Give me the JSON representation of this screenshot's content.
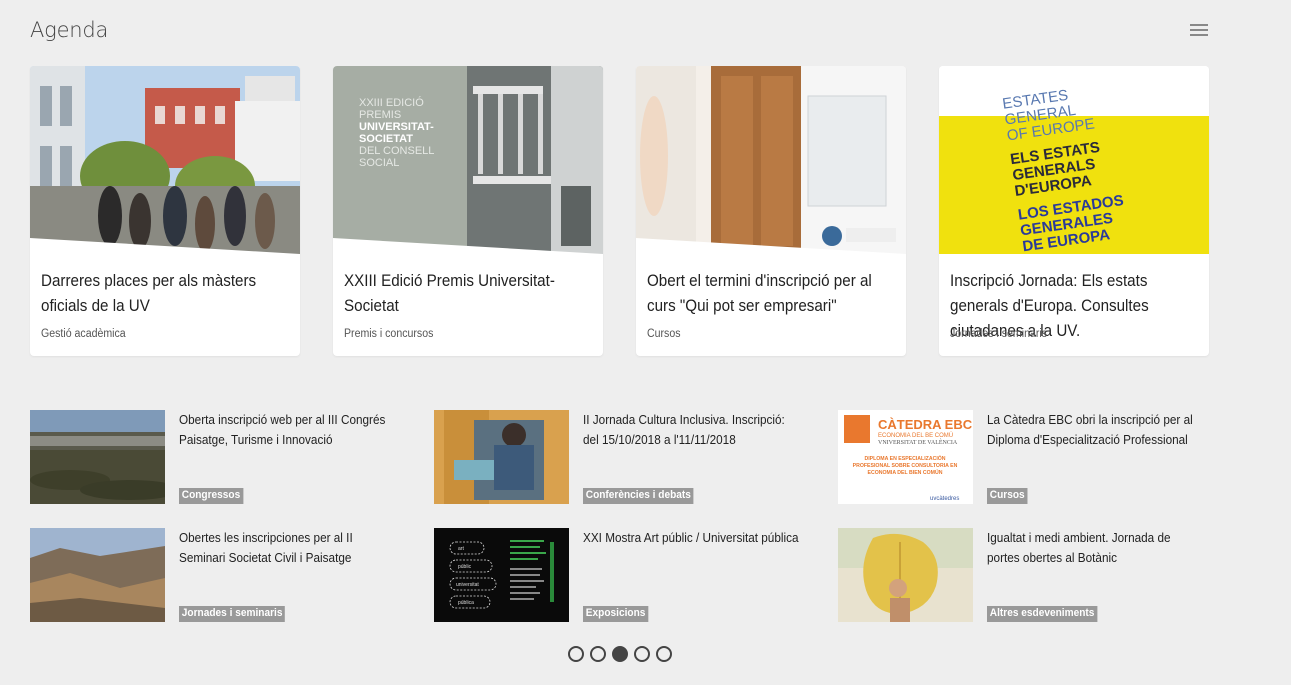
{
  "page": {
    "title": "Agenda",
    "menu_icon": "hamburger-menu-icon"
  },
  "featured": [
    {
      "title": "Darreres places per als màsters oficials de la UV",
      "category": "Gestió acadèmica"
    },
    {
      "title": "XXIII Edició Premis Universitat-Societat",
      "category": "Premis i concursos",
      "image_text": [
        "XXIII EDICIÓ",
        "PREMIS",
        "UNIVERSITAT-",
        "SOCIETAT",
        "DEL CONSELL",
        "SOCIAL"
      ]
    },
    {
      "title": "Obert el termini d'inscripció per al curs \"Qui pot ser empresari\"",
      "category": "Cursos"
    },
    {
      "title": "Inscripció Jornada: Els estats generals d'Europa. Consultes ciutadanes a la UV.",
      "category": "Jornades i seminaris",
      "image_text": [
        "ESTATES",
        "GENERAL",
        "OF EUROPE",
        "ELS ESTATS",
        "GENERALS",
        "D'EUROPA",
        "LOS ESTADOS",
        "GENERALES",
        "DE EUROPA"
      ]
    }
  ],
  "items": [
    {
      "title": "Oberta inscripció web per al III Congrés Paisatge, Turisme i Innovació",
      "category": "Congressos"
    },
    {
      "title": "II Jornada Cultura Inclusiva. Inscripció: del 15/10/2018 a l'11/11/2018",
      "category": "Conferències i debats"
    },
    {
      "title": "La Càtedra EBC obri la inscripció per al Diploma d'Especialització Professional",
      "category": "Cursos",
      "image_text": [
        "CÀTEDRA EBC",
        "ECONOMIA DEL BE COMÚ",
        "VNIVERSITAT DE VALÈNCIA",
        "DIPLOMA EN ESPECIALIZACIÓN",
        "PROFESIONAL SOBRE CONSULTORIA EN",
        "ECONOMIA DEL BIEN COMÚN",
        "uvcàtedres"
      ]
    },
    {
      "title": "Obertes les inscripciones per al II Seminari Societat Civil i Paisatge",
      "category": "Jornades i seminaris"
    },
    {
      "title": "XXI Mostra Art públic / Universitat pública",
      "category": "Exposicions",
      "image_text": [
        "art",
        "públic",
        "universitat",
        "pública"
      ]
    },
    {
      "title": "Igualtat i medi ambient. Jornada de portes obertes al Botànic",
      "category": "Altres esdeveniments"
    }
  ],
  "pagination": {
    "pages": 5,
    "active": 3
  }
}
